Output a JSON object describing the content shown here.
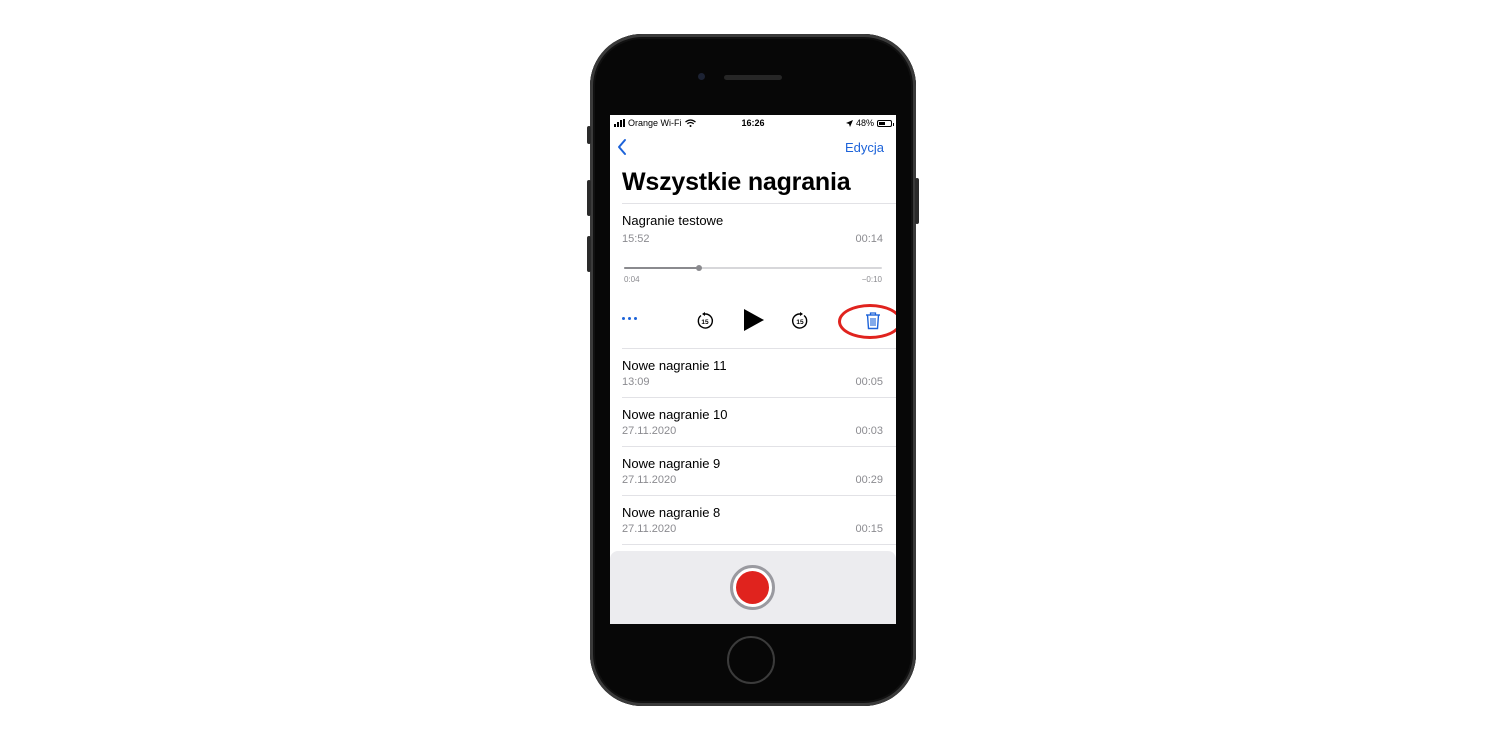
{
  "status_bar": {
    "carrier": "Orange Wi-Fi",
    "time": "16:26",
    "battery": "48%"
  },
  "nav": {
    "edit_label": "Edycja"
  },
  "page": {
    "title": "Wszystkie nagrania"
  },
  "expanded_recording": {
    "title": "Nagranie testowe",
    "date": "15:52",
    "duration": "00:14",
    "elapsed": "0:04",
    "remaining": "−0:10",
    "progress": 0.29,
    "skip_back_label": "15",
    "skip_forward_label": "15"
  },
  "recordings": [
    {
      "title": "Nowe nagranie 11",
      "date": "13:09",
      "duration": "00:05"
    },
    {
      "title": "Nowe nagranie 10",
      "date": "27.11.2020",
      "duration": "00:03"
    },
    {
      "title": "Nowe nagranie 9",
      "date": "27.11.2020",
      "duration": "00:29"
    },
    {
      "title": "Nowe nagranie 8",
      "date": "27.11.2020",
      "duration": "00:15"
    }
  ],
  "icons": {
    "back": "chevron-left-icon",
    "more": "ellipsis-icon",
    "skip_back": "skip-back-15-icon",
    "play": "play-icon",
    "skip_forward": "skip-forward-15-icon",
    "delete": "trash-icon",
    "record": "record-icon"
  },
  "colors": {
    "accent": "#1d63d9",
    "record": "#e0231e",
    "highlight": "#e0231e"
  }
}
